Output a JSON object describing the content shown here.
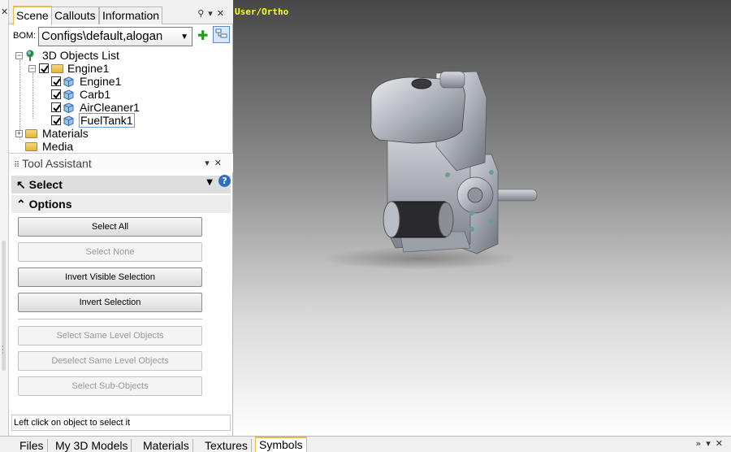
{
  "scene_panel": {
    "tabs": [
      {
        "label": "Scene",
        "active": true
      },
      {
        "label": "Callouts",
        "active": false
      },
      {
        "label": "Information",
        "active": false
      }
    ],
    "bom_label": "BOM:",
    "bom_value": "Configs\\default,alogan",
    "tree": {
      "root": "3D Objects List",
      "group": "Engine1",
      "children": [
        "Engine1",
        "Carb1",
        "AirCleaner1",
        "FuelTank1"
      ],
      "materials": "Materials",
      "media": "Media"
    }
  },
  "tool_assistant": {
    "title": "Tool Assistant",
    "tool_name": "Select",
    "options_title": "Options",
    "buttons": [
      {
        "label": "Select All",
        "enabled": true
      },
      {
        "label": "Select None",
        "enabled": false
      },
      {
        "label": "Invert Visible Selection",
        "enabled": true
      },
      {
        "label": "Invert Selection",
        "enabled": true
      },
      {
        "label": "Select Same Level Objects",
        "enabled": false
      },
      {
        "label": "Deselect Same Level Objects",
        "enabled": false
      },
      {
        "label": "Select Sub-Objects",
        "enabled": false
      }
    ],
    "status": "Left click on object to select it"
  },
  "viewport": {
    "view_label": "User/Ortho"
  },
  "bottom_tabs": [
    {
      "label": "Files",
      "active": false
    },
    {
      "label": "My 3D Models",
      "active": false
    },
    {
      "label": "Materials",
      "active": false
    },
    {
      "label": "Textures",
      "active": false
    },
    {
      "label": "Symbols",
      "active": true
    }
  ],
  "colors": {
    "accent_tab": "#e8b94b",
    "view_label": "#ffff33",
    "help_icon": "#2e6fc4",
    "add_icon": "#1c9d1c"
  }
}
